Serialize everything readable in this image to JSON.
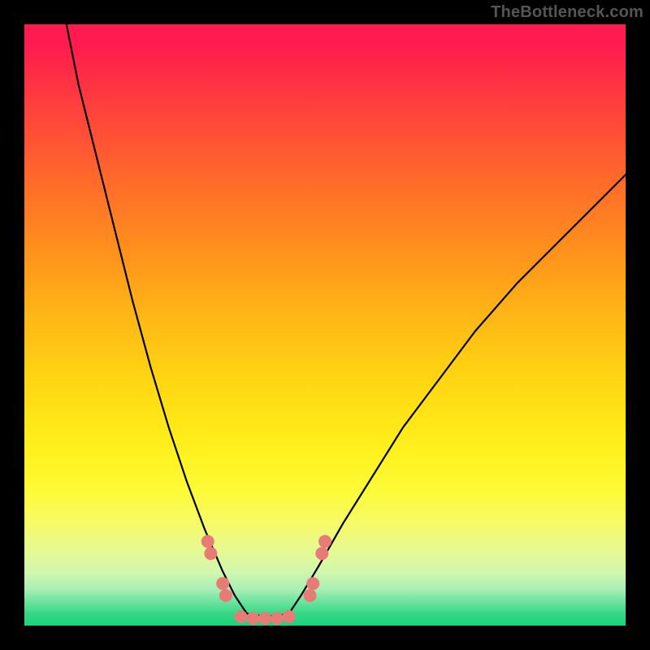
{
  "attribution": "TheBottleneck.com",
  "chart_data": {
    "type": "line",
    "title": "",
    "xlabel": "",
    "ylabel": "",
    "xlim": [
      0,
      100
    ],
    "ylim": [
      0,
      100
    ],
    "series": [
      {
        "name": "left-curve",
        "x": [
          7,
          9,
          12,
          15,
          18,
          21,
          24,
          27,
          30,
          33,
          35,
          37
        ],
        "y": [
          100,
          90,
          78,
          66,
          54,
          43,
          33,
          24,
          16,
          9,
          5,
          2
        ]
      },
      {
        "name": "right-curve",
        "x": [
          44,
          46,
          49,
          53,
          58,
          63,
          69,
          75,
          82,
          89,
          96,
          100
        ],
        "y": [
          2,
          5,
          10,
          17,
          25,
          33,
          41,
          49,
          57,
          64,
          71,
          75
        ]
      },
      {
        "name": "beads-left",
        "x": [
          30.5,
          31.0,
          33.0,
          33.5
        ],
        "y": [
          14,
          12,
          7,
          5
        ]
      },
      {
        "name": "beads-right",
        "x": [
          47.5,
          48.0,
          49.5,
          50.0
        ],
        "y": [
          5,
          7,
          12,
          14
        ]
      },
      {
        "name": "valley-floor",
        "x": [
          36,
          38,
          40,
          42,
          44
        ],
        "y": [
          1.5,
          1.2,
          1.2,
          1.2,
          1.5
        ]
      }
    ],
    "gradient_stops": [
      {
        "stop": 0,
        "color": "#ff1a4f"
      },
      {
        "stop": 50,
        "color": "#ffd312"
      },
      {
        "stop": 85,
        "color": "#f6fb68"
      },
      {
        "stop": 100,
        "color": "#1bd37c"
      }
    ],
    "bead_color": "#e77c77",
    "curve_color": "#000000"
  }
}
